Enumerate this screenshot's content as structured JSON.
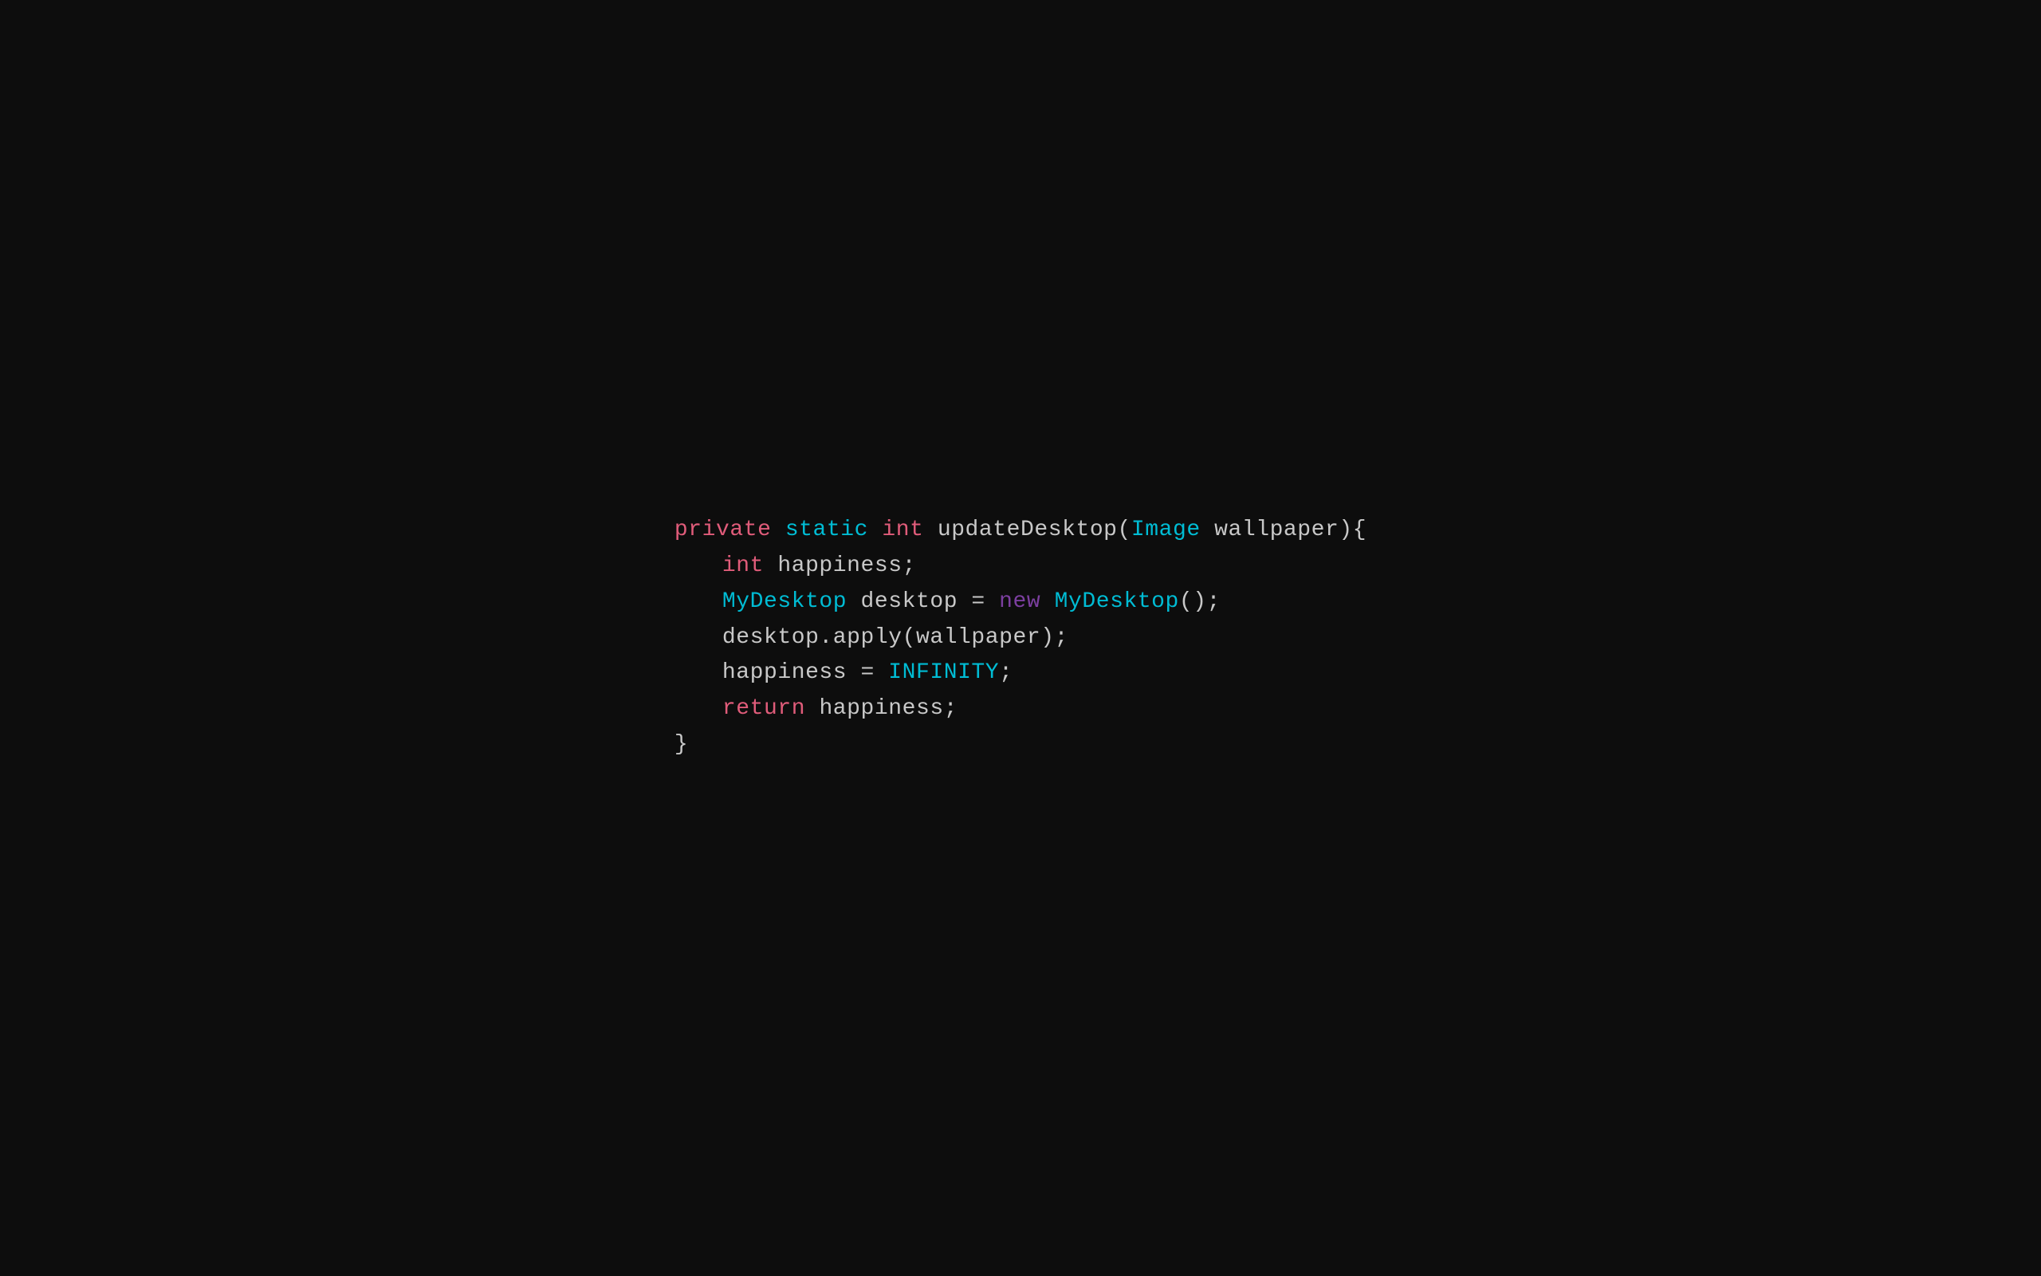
{
  "background": "#0d0d0d",
  "code": {
    "line1": {
      "parts": [
        {
          "text": "private",
          "class": "kw-private"
        },
        {
          "text": " ",
          "class": "plain"
        },
        {
          "text": "static",
          "class": "kw-static"
        },
        {
          "text": " ",
          "class": "plain"
        },
        {
          "text": "int",
          "class": "kw-int"
        },
        {
          "text": " updateDesktop(",
          "class": "plain"
        },
        {
          "text": "Image",
          "class": "kw-image"
        },
        {
          "text": " wallpaper){",
          "class": "plain"
        }
      ]
    },
    "line2": {
      "indent": 1,
      "parts": [
        {
          "text": "int",
          "class": "kw-int"
        },
        {
          "text": " happiness;",
          "class": "plain"
        }
      ]
    },
    "line3": {
      "indent": 1,
      "parts": [
        {
          "text": "MyDesktop",
          "class": "kw-mydesktop"
        },
        {
          "text": " desktop = ",
          "class": "plain"
        },
        {
          "text": "new",
          "class": "kw-new"
        },
        {
          "text": " ",
          "class": "plain"
        },
        {
          "text": "MyDesktop",
          "class": "kw-mydesktop"
        },
        {
          "text": "();",
          "class": "plain"
        }
      ]
    },
    "line4": {
      "indent": 1,
      "parts": [
        {
          "text": "desktop.apply(wallpaper);",
          "class": "plain"
        }
      ]
    },
    "line5": {
      "indent": 1,
      "parts": [
        {
          "text": "happiness = ",
          "class": "plain"
        },
        {
          "text": "INFINITY",
          "class": "kw-infinity"
        },
        {
          "text": ";",
          "class": "plain"
        }
      ]
    },
    "line6": {
      "indent": 1,
      "parts": [
        {
          "text": "return",
          "class": "kw-return"
        },
        {
          "text": " happiness;",
          "class": "plain"
        }
      ]
    },
    "line7": {
      "parts": [
        {
          "text": "}",
          "class": "plain"
        }
      ]
    }
  }
}
